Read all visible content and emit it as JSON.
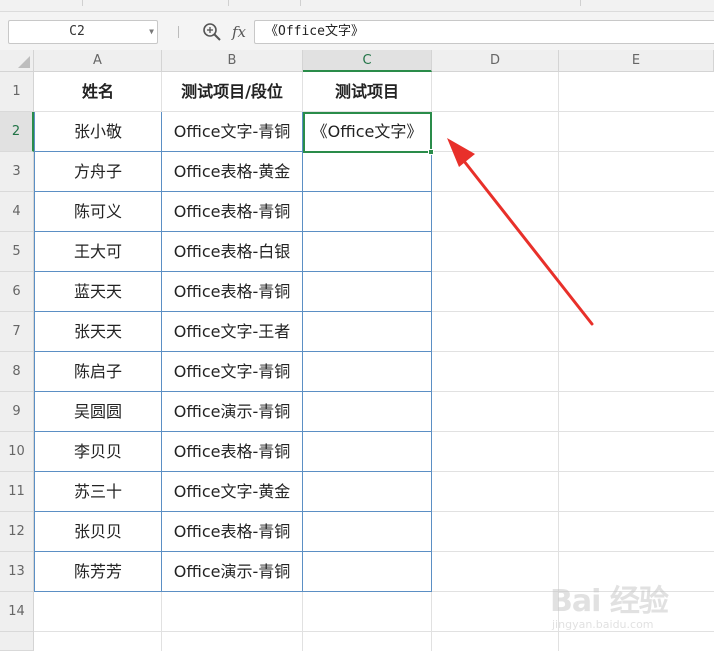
{
  "namebox": {
    "value": "C2"
  },
  "formula_bar": {
    "fx_label": "fx",
    "content": "《Office文字》"
  },
  "columns": [
    "A",
    "B",
    "C",
    "D",
    "E"
  ],
  "selected_column": "C",
  "rows": [
    "1",
    "2",
    "3",
    "4",
    "5",
    "6",
    "7",
    "8",
    "9",
    "10",
    "11",
    "12",
    "13",
    "14"
  ],
  "selected_row": "2",
  "sheet": {
    "headers": [
      "姓名",
      "测试项目/段位",
      "测试项目"
    ],
    "records": [
      {
        "name": "张小敬",
        "item": "Office文字-青铜",
        "result": "《Office文字》"
      },
      {
        "name": "方舟子",
        "item": "Office表格-黄金",
        "result": ""
      },
      {
        "name": "陈可义",
        "item": "Office表格-青铜",
        "result": ""
      },
      {
        "name": "王大可",
        "item": "Office表格-白银",
        "result": ""
      },
      {
        "name": "蓝天天",
        "item": "Office表格-青铜",
        "result": ""
      },
      {
        "name": "张天天",
        "item": "Office文字-王者",
        "result": ""
      },
      {
        "name": "陈启子",
        "item": "Office文字-青铜",
        "result": ""
      },
      {
        "name": "吴圆圆",
        "item": "Office演示-青铜",
        "result": ""
      },
      {
        "name": "李贝贝",
        "item": "Office表格-青铜",
        "result": ""
      },
      {
        "name": "苏三十",
        "item": "Office文字-黄金",
        "result": ""
      },
      {
        "name": "张贝贝",
        "item": "Office表格-青铜",
        "result": ""
      },
      {
        "name": "陈芳芳",
        "item": "Office演示-青铜",
        "result": ""
      }
    ]
  },
  "annotation": {
    "arrow_color": "#e8302a"
  },
  "watermark": {
    "main": "Bai 经验",
    "sub": "jingyan.baidu.com"
  },
  "colors": {
    "selection": "#2a8c4a",
    "table_border": "#5b8fc4"
  }
}
